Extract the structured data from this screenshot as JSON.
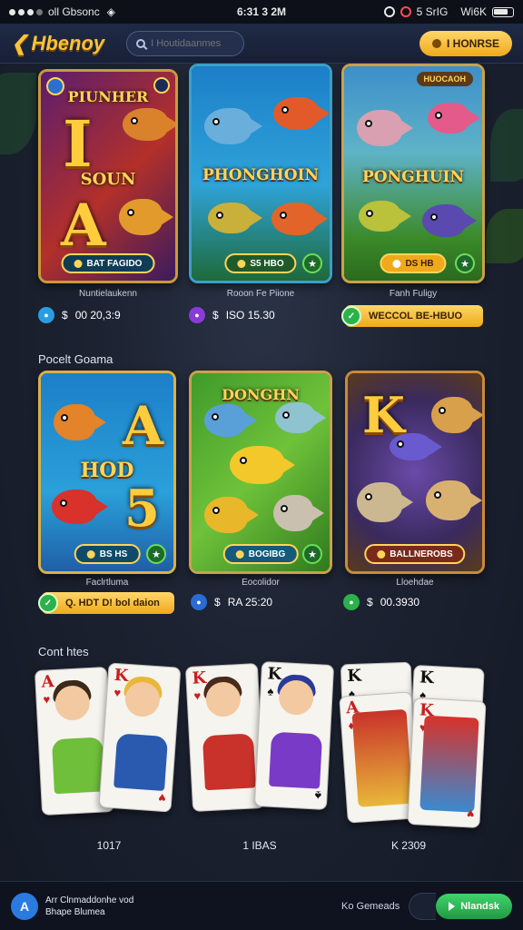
{
  "statusbar": {
    "carrier": "oll Gbsonc",
    "time": "6:31 3 2M",
    "network": "5 SrIG",
    "battery_label": "Wi6K"
  },
  "header": {
    "logo_text": "Hbenoy",
    "search_placeholder": "I Houtidaanmes",
    "cta_label": "I HONRSE"
  },
  "row1": {
    "cards": [
      {
        "title_top": "PIUNHER",
        "title_mid": "SOUN",
        "letter_a": "I",
        "letter_b": "A",
        "pill": "BAT FAGIDO",
        "caption": "Nuntielaukenn",
        "stat_icon": "$",
        "stat_text": "00 20,3:9",
        "icon_color": "#2a9de0"
      },
      {
        "title_mid": "PHONGHOIN",
        "pill": "S5 HBO",
        "caption": "Rooon Fe Piione",
        "stat_icon": "$",
        "stat_text": "ISO 15.30",
        "icon_color": "#8a3ad6"
      },
      {
        "top_tag": "HUOCAOH",
        "title_mid": "PONGHUIN",
        "pill": "DS HB",
        "caption": "Fanh Fuligy",
        "button_text": "WECCOL BE-HBUO"
      }
    ]
  },
  "section2_title": "Pocelt Goama",
  "row2": {
    "cards": [
      {
        "letter_a": "A",
        "title_mid": "HOD",
        "letter_b": "5",
        "pill": "BS HS",
        "caption": "Faclrtluma",
        "button_text": "Q. HDT D! bol daion"
      },
      {
        "title_top": "DONGHN",
        "pill": "BOGIBG",
        "caption": "Eocolidor",
        "stat_icon": "$",
        "stat_text": "RA 25:20",
        "icon_color": "#2a6bd6"
      },
      {
        "letter_a": "K",
        "pill": "BALLNEROBS",
        "caption": "Lloehdae",
        "stat_icon": "$",
        "stat_text": "00.3930",
        "icon_color": "#2bb24a"
      }
    ]
  },
  "section3_title": "Cont htes",
  "playing_cards": {
    "groups": [
      {
        "count": "1017"
      },
      {
        "count": "1 IBAS"
      },
      {
        "count": "K 2309"
      }
    ]
  },
  "bottombar": {
    "logo_icon": "A",
    "line1": "Arr Clnmaddonhe vod",
    "line2": "Bhape Blumea",
    "link": "Ko Gemeads",
    "button_label": "Nlandsk"
  }
}
